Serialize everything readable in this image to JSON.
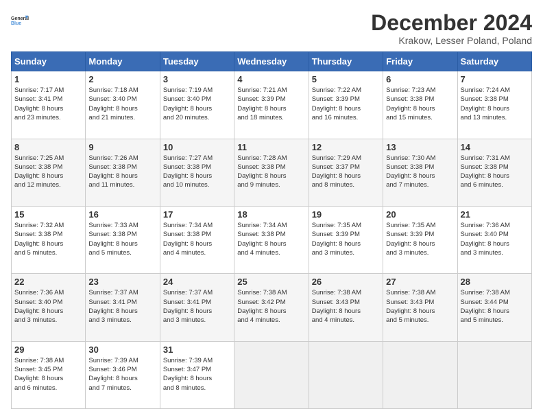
{
  "logo": {
    "line1": "General",
    "line2": "Blue"
  },
  "title": "December 2024",
  "subtitle": "Krakow, Lesser Poland, Poland",
  "days_header": [
    "Sunday",
    "Monday",
    "Tuesday",
    "Wednesday",
    "Thursday",
    "Friday",
    "Saturday"
  ],
  "weeks": [
    [
      {
        "day": "1",
        "info": "Sunrise: 7:17 AM\nSunset: 3:41 PM\nDaylight: 8 hours\nand 23 minutes."
      },
      {
        "day": "2",
        "info": "Sunrise: 7:18 AM\nSunset: 3:40 PM\nDaylight: 8 hours\nand 21 minutes."
      },
      {
        "day": "3",
        "info": "Sunrise: 7:19 AM\nSunset: 3:40 PM\nDaylight: 8 hours\nand 20 minutes."
      },
      {
        "day": "4",
        "info": "Sunrise: 7:21 AM\nSunset: 3:39 PM\nDaylight: 8 hours\nand 18 minutes."
      },
      {
        "day": "5",
        "info": "Sunrise: 7:22 AM\nSunset: 3:39 PM\nDaylight: 8 hours\nand 16 minutes."
      },
      {
        "day": "6",
        "info": "Sunrise: 7:23 AM\nSunset: 3:38 PM\nDaylight: 8 hours\nand 15 minutes."
      },
      {
        "day": "7",
        "info": "Sunrise: 7:24 AM\nSunset: 3:38 PM\nDaylight: 8 hours\nand 13 minutes."
      }
    ],
    [
      {
        "day": "8",
        "info": "Sunrise: 7:25 AM\nSunset: 3:38 PM\nDaylight: 8 hours\nand 12 minutes."
      },
      {
        "day": "9",
        "info": "Sunrise: 7:26 AM\nSunset: 3:38 PM\nDaylight: 8 hours\nand 11 minutes."
      },
      {
        "day": "10",
        "info": "Sunrise: 7:27 AM\nSunset: 3:38 PM\nDaylight: 8 hours\nand 10 minutes."
      },
      {
        "day": "11",
        "info": "Sunrise: 7:28 AM\nSunset: 3:38 PM\nDaylight: 8 hours\nand 9 minutes."
      },
      {
        "day": "12",
        "info": "Sunrise: 7:29 AM\nSunset: 3:37 PM\nDaylight: 8 hours\nand 8 minutes."
      },
      {
        "day": "13",
        "info": "Sunrise: 7:30 AM\nSunset: 3:38 PM\nDaylight: 8 hours\nand 7 minutes."
      },
      {
        "day": "14",
        "info": "Sunrise: 7:31 AM\nSunset: 3:38 PM\nDaylight: 8 hours\nand 6 minutes."
      }
    ],
    [
      {
        "day": "15",
        "info": "Sunrise: 7:32 AM\nSunset: 3:38 PM\nDaylight: 8 hours\nand 5 minutes."
      },
      {
        "day": "16",
        "info": "Sunrise: 7:33 AM\nSunset: 3:38 PM\nDaylight: 8 hours\nand 5 minutes."
      },
      {
        "day": "17",
        "info": "Sunrise: 7:34 AM\nSunset: 3:38 PM\nDaylight: 8 hours\nand 4 minutes."
      },
      {
        "day": "18",
        "info": "Sunrise: 7:34 AM\nSunset: 3:38 PM\nDaylight: 8 hours\nand 4 minutes."
      },
      {
        "day": "19",
        "info": "Sunrise: 7:35 AM\nSunset: 3:39 PM\nDaylight: 8 hours\nand 3 minutes."
      },
      {
        "day": "20",
        "info": "Sunrise: 7:35 AM\nSunset: 3:39 PM\nDaylight: 8 hours\nand 3 minutes."
      },
      {
        "day": "21",
        "info": "Sunrise: 7:36 AM\nSunset: 3:40 PM\nDaylight: 8 hours\nand 3 minutes."
      }
    ],
    [
      {
        "day": "22",
        "info": "Sunrise: 7:36 AM\nSunset: 3:40 PM\nDaylight: 8 hours\nand 3 minutes."
      },
      {
        "day": "23",
        "info": "Sunrise: 7:37 AM\nSunset: 3:41 PM\nDaylight: 8 hours\nand 3 minutes."
      },
      {
        "day": "24",
        "info": "Sunrise: 7:37 AM\nSunset: 3:41 PM\nDaylight: 8 hours\nand 3 minutes."
      },
      {
        "day": "25",
        "info": "Sunrise: 7:38 AM\nSunset: 3:42 PM\nDaylight: 8 hours\nand 4 minutes."
      },
      {
        "day": "26",
        "info": "Sunrise: 7:38 AM\nSunset: 3:43 PM\nDaylight: 8 hours\nand 4 minutes."
      },
      {
        "day": "27",
        "info": "Sunrise: 7:38 AM\nSunset: 3:43 PM\nDaylight: 8 hours\nand 5 minutes."
      },
      {
        "day": "28",
        "info": "Sunrise: 7:38 AM\nSunset: 3:44 PM\nDaylight: 8 hours\nand 5 minutes."
      }
    ],
    [
      {
        "day": "29",
        "info": "Sunrise: 7:38 AM\nSunset: 3:45 PM\nDaylight: 8 hours\nand 6 minutes."
      },
      {
        "day": "30",
        "info": "Sunrise: 7:39 AM\nSunset: 3:46 PM\nDaylight: 8 hours\nand 7 minutes."
      },
      {
        "day": "31",
        "info": "Sunrise: 7:39 AM\nSunset: 3:47 PM\nDaylight: 8 hours\nand 8 minutes."
      },
      {
        "day": "",
        "info": ""
      },
      {
        "day": "",
        "info": ""
      },
      {
        "day": "",
        "info": ""
      },
      {
        "day": "",
        "info": ""
      }
    ]
  ]
}
